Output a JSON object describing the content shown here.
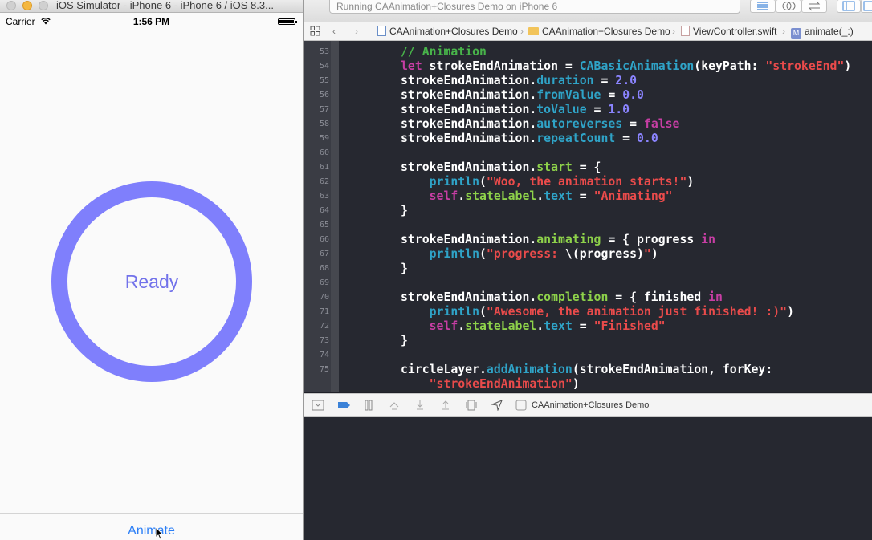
{
  "simulator": {
    "title": "iOS Simulator - iPhone 6 - iPhone 6 / iOS 8.3...",
    "status_bar": {
      "carrier": "Carrier",
      "time": "1:56 PM"
    },
    "state_label": "Ready",
    "ring_color": "#7f7ffc",
    "animate_button": "Animate"
  },
  "xcode": {
    "activity": "Running CAAnimation+Closures Demo on iPhone 6",
    "jump_bar": [
      "CAAnimation+Closures Demo",
      "CAAnimation+Closures Demo",
      "ViewController.swift",
      "animate(_:)"
    ],
    "debug_target": "CAAnimation+Closures Demo",
    "code_lines": [
      {
        "n": "53",
        "tokens": [
          {
            "t": "// Animation",
            "c": "com"
          }
        ]
      },
      {
        "n": "54",
        "tokens": [
          {
            "t": "let",
            "c": "kw"
          },
          {
            "t": " strokeEndAnimation = ",
            "c": "plain"
          },
          {
            "t": "CABasicAnimation",
            "c": "type"
          },
          {
            "t": "(keyPath: ",
            "c": "plain"
          },
          {
            "t": "\"strokeEnd\"",
            "c": "str"
          },
          {
            "t": ")",
            "c": "plain"
          }
        ]
      },
      {
        "n": "55",
        "tokens": [
          {
            "t": "strokeEndAnimation.",
            "c": "plain"
          },
          {
            "t": "duration",
            "c": "prop"
          },
          {
            "t": " = ",
            "c": "plain"
          },
          {
            "t": "2.0",
            "c": "num"
          }
        ]
      },
      {
        "n": "56",
        "tokens": [
          {
            "t": "strokeEndAnimation.",
            "c": "plain"
          },
          {
            "t": "fromValue",
            "c": "prop"
          },
          {
            "t": " = ",
            "c": "plain"
          },
          {
            "t": "0.0",
            "c": "num"
          }
        ]
      },
      {
        "n": "57",
        "tokens": [
          {
            "t": "strokeEndAnimation.",
            "c": "plain"
          },
          {
            "t": "toValue",
            "c": "prop"
          },
          {
            "t": " = ",
            "c": "plain"
          },
          {
            "t": "1.0",
            "c": "num"
          }
        ]
      },
      {
        "n": "58",
        "tokens": [
          {
            "t": "strokeEndAnimation.",
            "c": "plain"
          },
          {
            "t": "autoreverses",
            "c": "prop"
          },
          {
            "t": " = ",
            "c": "plain"
          },
          {
            "t": "false",
            "c": "kw"
          }
        ]
      },
      {
        "n": "59",
        "tokens": [
          {
            "t": "strokeEndAnimation.",
            "c": "plain"
          },
          {
            "t": "repeatCount",
            "c": "prop"
          },
          {
            "t": " = ",
            "c": "plain"
          },
          {
            "t": "0.0",
            "c": "num"
          }
        ]
      },
      {
        "n": "60",
        "tokens": []
      },
      {
        "n": "61",
        "tokens": [
          {
            "t": "strokeEndAnimation.",
            "c": "plain"
          },
          {
            "t": "start",
            "c": "fn"
          },
          {
            "t": " = {",
            "c": "plain"
          }
        ]
      },
      {
        "n": "62",
        "tokens": [
          {
            "t": "    ",
            "c": "plain"
          },
          {
            "t": "println",
            "c": "prop"
          },
          {
            "t": "(",
            "c": "plain"
          },
          {
            "t": "\"Woo, the animation starts!\"",
            "c": "str"
          },
          {
            "t": ")",
            "c": "plain"
          }
        ]
      },
      {
        "n": "63",
        "tokens": [
          {
            "t": "    ",
            "c": "plain"
          },
          {
            "t": "self",
            "c": "kw"
          },
          {
            "t": ".",
            "c": "plain"
          },
          {
            "t": "stateLabel",
            "c": "fn"
          },
          {
            "t": ".",
            "c": "plain"
          },
          {
            "t": "text",
            "c": "prop"
          },
          {
            "t": " = ",
            "c": "plain"
          },
          {
            "t": "\"Animating\"",
            "c": "str"
          }
        ]
      },
      {
        "n": "64",
        "tokens": [
          {
            "t": "}",
            "c": "plain"
          }
        ]
      },
      {
        "n": "65",
        "tokens": []
      },
      {
        "n": "66",
        "tokens": [
          {
            "t": "strokeEndAnimation.",
            "c": "plain"
          },
          {
            "t": "animating",
            "c": "fn"
          },
          {
            "t": " = { progress ",
            "c": "plain"
          },
          {
            "t": "in",
            "c": "kw"
          }
        ]
      },
      {
        "n": "67",
        "tokens": [
          {
            "t": "    ",
            "c": "plain"
          },
          {
            "t": "println",
            "c": "prop"
          },
          {
            "t": "(",
            "c": "plain"
          },
          {
            "t": "\"progress: ",
            "c": "str"
          },
          {
            "t": "\\(progress)",
            "c": "plain"
          },
          {
            "t": "\"",
            "c": "str"
          },
          {
            "t": ")",
            "c": "plain"
          }
        ]
      },
      {
        "n": "68",
        "tokens": [
          {
            "t": "}",
            "c": "plain"
          }
        ]
      },
      {
        "n": "69",
        "tokens": []
      },
      {
        "n": "70",
        "tokens": [
          {
            "t": "strokeEndAnimation.",
            "c": "plain"
          },
          {
            "t": "completion",
            "c": "fn"
          },
          {
            "t": " = { finished ",
            "c": "plain"
          },
          {
            "t": "in",
            "c": "kw"
          }
        ]
      },
      {
        "n": "71",
        "tokens": [
          {
            "t": "    ",
            "c": "plain"
          },
          {
            "t": "println",
            "c": "prop"
          },
          {
            "t": "(",
            "c": "plain"
          },
          {
            "t": "\"Awesome, the animation just finished! :)\"",
            "c": "str"
          },
          {
            "t": ")",
            "c": "plain"
          }
        ]
      },
      {
        "n": "72",
        "tokens": [
          {
            "t": "    ",
            "c": "plain"
          },
          {
            "t": "self",
            "c": "kw"
          },
          {
            "t": ".",
            "c": "plain"
          },
          {
            "t": "stateLabel",
            "c": "fn"
          },
          {
            "t": ".",
            "c": "plain"
          },
          {
            "t": "text",
            "c": "prop"
          },
          {
            "t": " = ",
            "c": "plain"
          },
          {
            "t": "\"Finished\"",
            "c": "str"
          }
        ]
      },
      {
        "n": "73",
        "tokens": [
          {
            "t": "}",
            "c": "plain"
          }
        ]
      },
      {
        "n": "74",
        "tokens": []
      },
      {
        "n": "75",
        "tokens": [
          {
            "t": "circleLayer.",
            "c": "plain"
          },
          {
            "t": "addAnimation",
            "c": "prop"
          },
          {
            "t": "(strokeEndAnimation, forKey:",
            "c": "plain"
          }
        ]
      },
      {
        "n": "",
        "tokens": [
          {
            "t": "    ",
            "c": "plain"
          },
          {
            "t": "\"strokeEndAnimation\"",
            "c": "str"
          },
          {
            "t": ")",
            "c": "plain"
          }
        ]
      }
    ]
  }
}
